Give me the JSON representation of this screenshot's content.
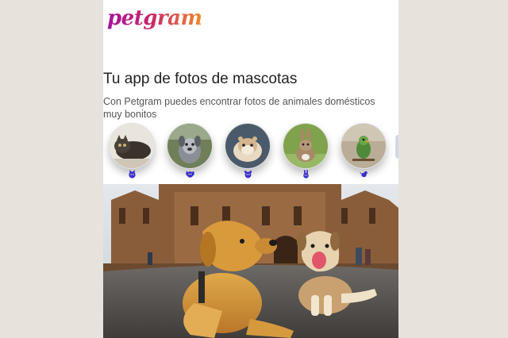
{
  "header": {
    "logo_text": "petgram"
  },
  "main": {
    "title": "Tu app de fotos de mascotas",
    "subtitle": "Con Petgram puedes encontrar fotos de animales domésticos muy bonitos"
  },
  "categories": [
    {
      "icon": "cat-face-icon",
      "color": "#3b2fc9"
    },
    {
      "icon": "dog-face-icon",
      "color": "#3b2fc9"
    },
    {
      "icon": "hamster-face-icon",
      "color": "#3b2fc9"
    },
    {
      "icon": "rabbit-face-icon",
      "color": "#3b2fc9"
    },
    {
      "icon": "bird-icon",
      "color": "#3b2fc9"
    }
  ],
  "feed": {
    "photo": "two-dogs-lying-in-front-of-cathedral"
  },
  "colors": {
    "page_bg": "#e8e2dd",
    "app_bg": "#ffffff",
    "icon_color": "#3b2fc9"
  }
}
